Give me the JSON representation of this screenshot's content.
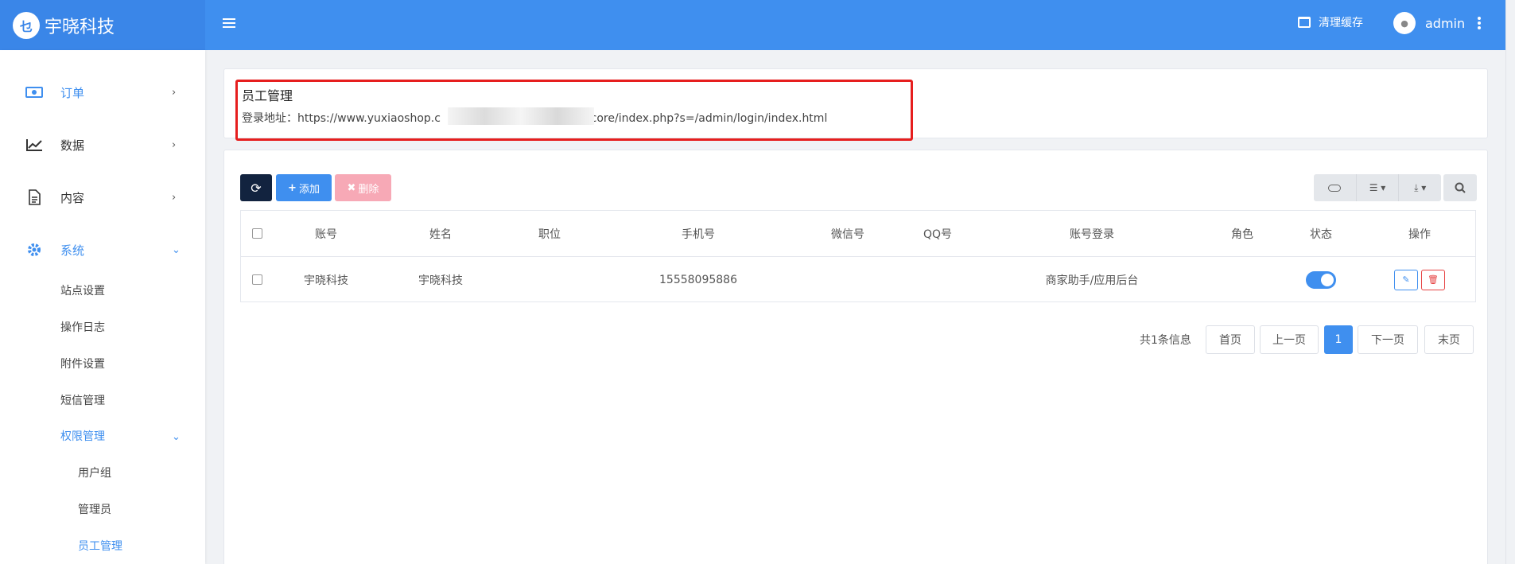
{
  "header": {
    "brand_name": "宇晓科技",
    "logo_text": "乜",
    "clear_cache": "清理缓存",
    "username": "admin",
    "color": "#3f8fef"
  },
  "sidebar": {
    "items": [
      {
        "label": "订单",
        "icon": "money-icon"
      },
      {
        "label": "数据",
        "icon": "chart-line-icon"
      },
      {
        "label": "内容",
        "icon": "document-icon"
      },
      {
        "label": "系统",
        "icon": "gear-icon"
      }
    ],
    "system_sub": [
      "站点设置",
      "操作日志",
      "附件设置",
      "短信管理",
      "权限管理"
    ],
    "permission_sub": [
      "用户组",
      "管理员",
      "员工管理"
    ]
  },
  "page": {
    "title": "员工管理",
    "login_prefix": "登录地址：",
    "login_url_start": "https://www.yuxiaoshop.c",
    "login_url_end": "/core/index.php?s=/admin/login/index.html"
  },
  "toolbar": {
    "add": "添加",
    "delete": "删除"
  },
  "table": {
    "columns": [
      "账号",
      "姓名",
      "职位",
      "手机号",
      "微信号",
      "QQ号",
      "账号登录",
      "角色",
      "状态",
      "操作"
    ],
    "rows": [
      {
        "account": "宇晓科技",
        "name": "宇晓科技",
        "position": "",
        "phone": "15558095886",
        "wechat": "",
        "qq": "",
        "login": "商家助手/应用后台",
        "role": "",
        "status": "on"
      }
    ]
  },
  "pagination": {
    "total": "共1条信息",
    "first": "首页",
    "prev": "上一页",
    "current": "1",
    "next": "下一页",
    "last": "末页"
  }
}
